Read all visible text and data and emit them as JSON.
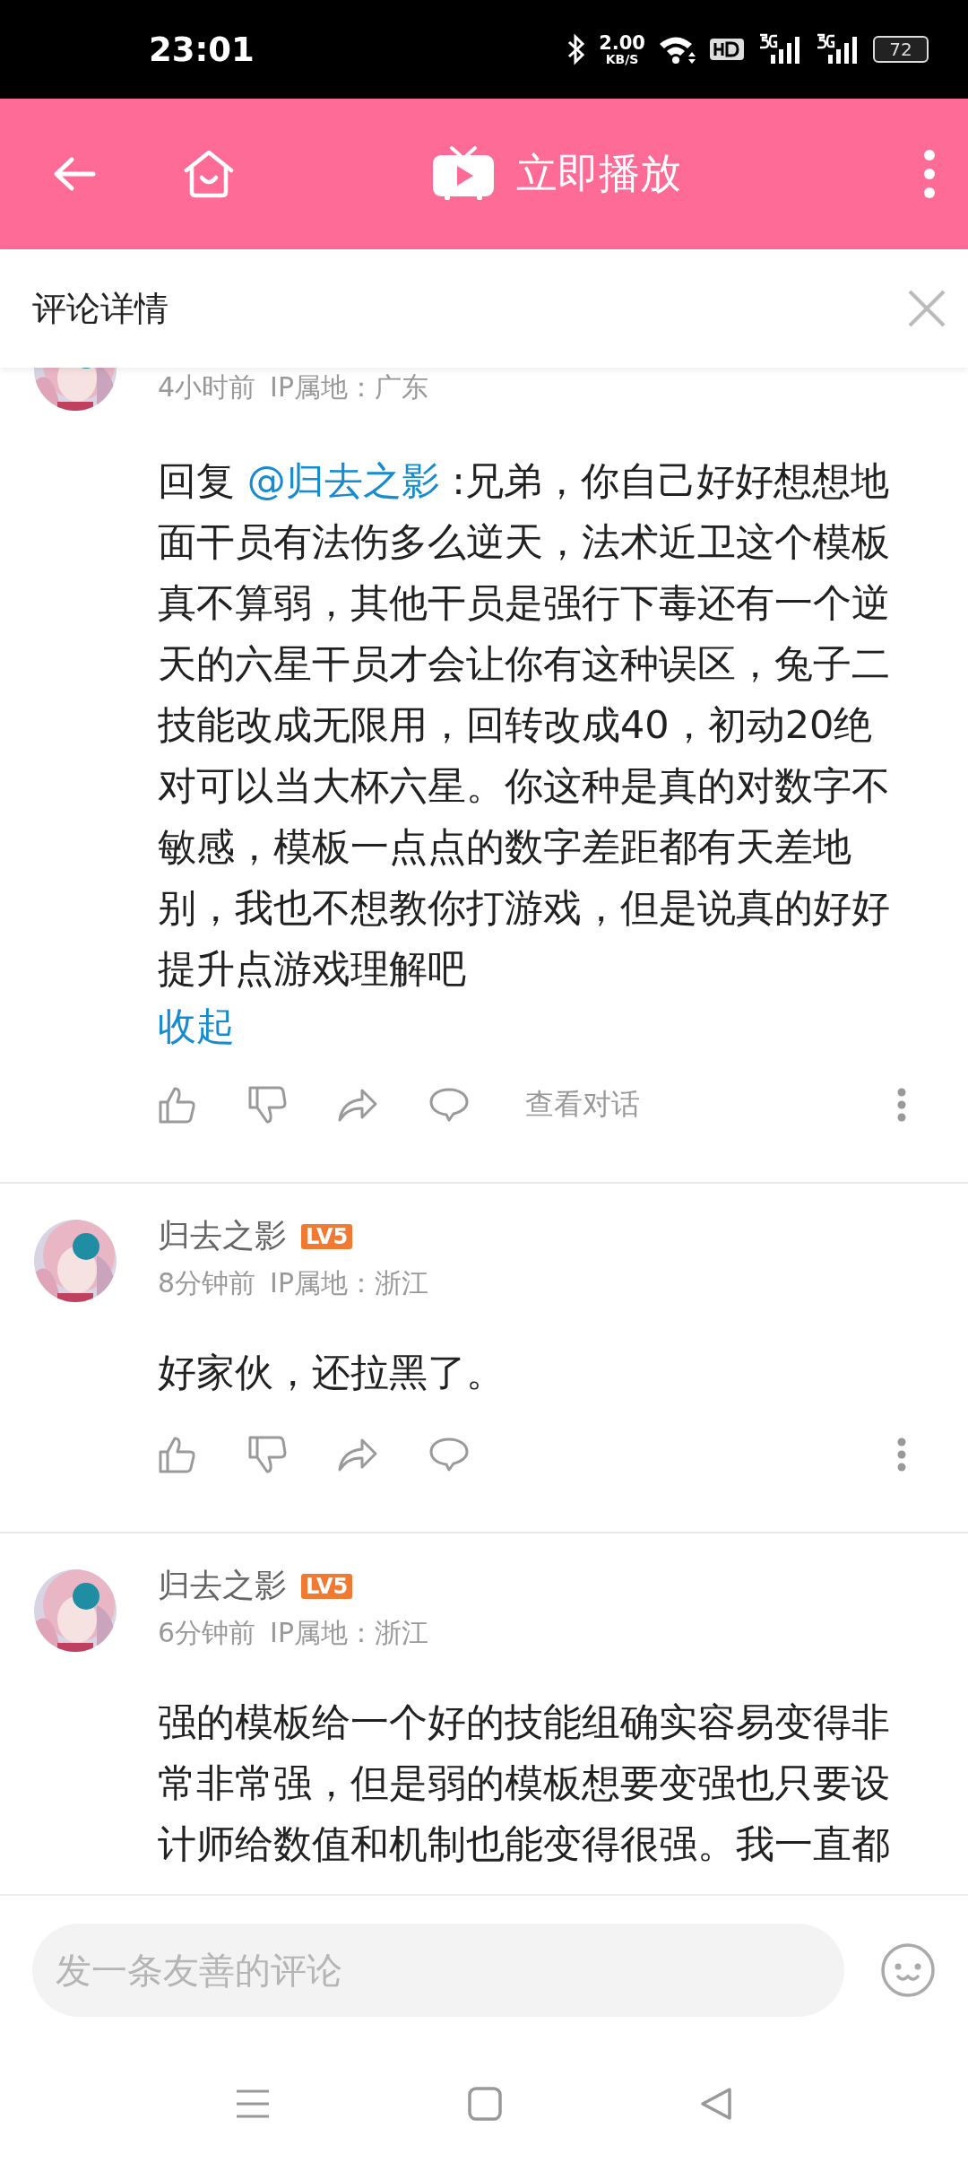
{
  "status_bar": {
    "time": "23:01",
    "net_speed": "2.00",
    "net_unit": "KB/S",
    "battery": "72"
  },
  "header": {
    "title": "立即播放"
  },
  "panel": {
    "title": "评论详情"
  },
  "comments": [
    {
      "kind": "reply",
      "time": "4小时前",
      "ip": "IP属地：广东",
      "reply_prefix": "回复",
      "mention": "@归去之影",
      "body": ":兄弟，你自己好好想想地面干员有法伤多么逆天，法术近卫这个模板真不算弱，其他干员是强行下毒还有一个逆天的六星干员才会让你有这种误区，兔子二技能改成无限用，回转改成40，初动20绝对可以当大杯六星。你这种是真的对数字不敏感，模板一点点的数字差距都有天差地别，我也不想教你打游戏，但是说真的好好提升点游戏理解吧",
      "collapse": "收起",
      "conversation": "查看对话"
    },
    {
      "kind": "comment",
      "author": "归去之影",
      "level": "LV5",
      "time": "8分钟前",
      "ip": "IP属地：浙江",
      "body": "好家伙，还拉黑了。"
    },
    {
      "kind": "truncated",
      "author": "归去之影",
      "level": "LV5",
      "time": "6分钟前",
      "ip": "IP属地：浙江",
      "body": "强的模板给一个好的技能组确实容易变得非常非常强，但是弱的模板想要变强也只要设计师给数值和机制也能变得很强。我一直都"
    }
  ],
  "composer": {
    "placeholder": "发一条友善的评论"
  }
}
